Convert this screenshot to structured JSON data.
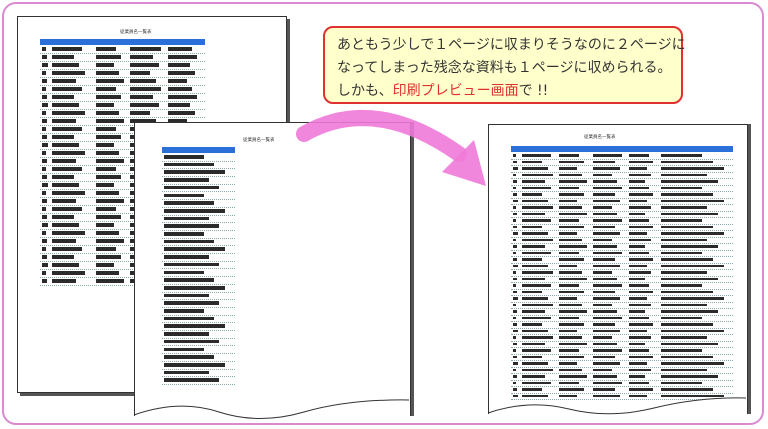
{
  "callout": {
    "line1": "あともう少しで１ページに収まりそうなのに２ページに",
    "line2": "なってしまった残念な資料も１ページに収められる。",
    "line3_pre": "しかも、",
    "line3_highlight": "印刷プレビュー画面",
    "line3_post": "で !!"
  },
  "pages": {
    "back_title": "従業員名一覧表",
    "middle_title": "従業員名一覧表",
    "result_title": "従業員名一覧表"
  },
  "colors": {
    "frame_border": "#d98ad0",
    "header_blue": "#2b6fd9",
    "callout_bg": "#ffffcc",
    "callout_border": "#e03030",
    "highlight_text": "#e03030",
    "arrow_pink": "#f07ad8"
  },
  "icons": {
    "arrow": "curved-arrow-icon"
  }
}
